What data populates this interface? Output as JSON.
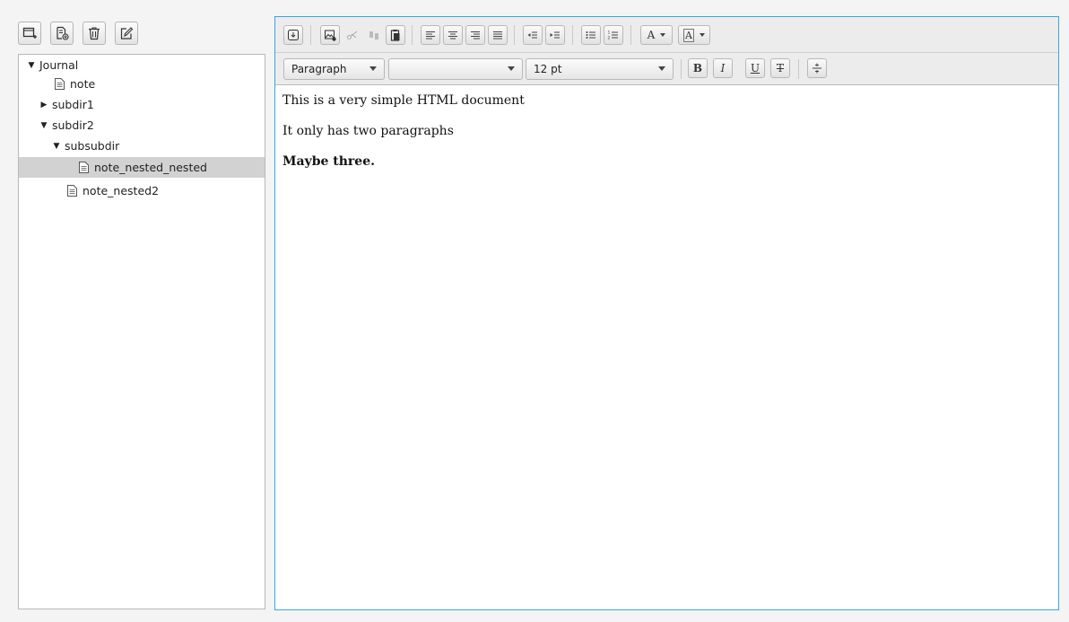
{
  "sidebar": {
    "toolbar": [
      {
        "name": "new-folder-icon"
      },
      {
        "name": "new-note-icon"
      },
      {
        "name": "trash-icon"
      },
      {
        "name": "edit-icon"
      }
    ],
    "tree": {
      "journal": "Journal",
      "note": "note",
      "subdir1": "subdir1",
      "subdir2": "subdir2",
      "subsubdir": "subsubdir",
      "note_nested_nested": "note_nested_nested",
      "note_nested2": "note_nested2"
    }
  },
  "editor": {
    "paragraph_style": "Paragraph",
    "font_family": "",
    "font_size": "12 pt",
    "bold_label": "B",
    "italic_label": "I",
    "underline_label": "U",
    "strike_label": "T",
    "text_color_label": "A",
    "bg_color_label": "A",
    "content": [
      {
        "text": "This is a very simple HTML document",
        "bold": false
      },
      {
        "text": "It only has two paragraphs",
        "bold": false
      },
      {
        "text": "Maybe three.",
        "bold": true
      }
    ],
    "accent_color": "#39a6e2"
  }
}
